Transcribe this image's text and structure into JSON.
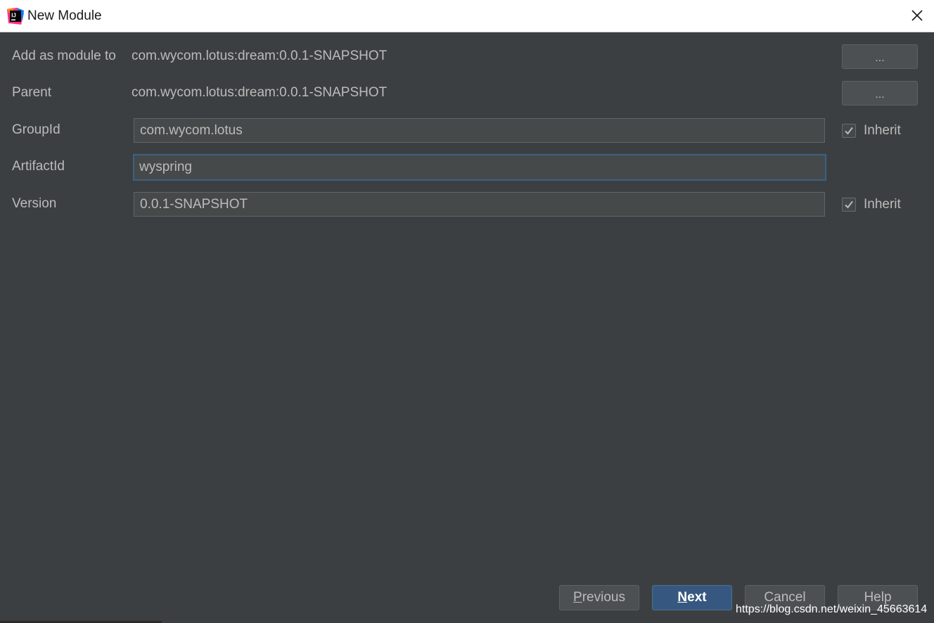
{
  "window": {
    "title": "New Module",
    "icon": "intellij-idea-icon"
  },
  "form": {
    "add_as_module_to": {
      "label": "Add as module to",
      "value": "com.wycom.lotus:dream:0.0.1-SNAPSHOT",
      "button_label": "..."
    },
    "parent": {
      "label": "Parent",
      "value": "com.wycom.lotus:dream:0.0.1-SNAPSHOT",
      "button_label": "..."
    },
    "group_id": {
      "label": "GroupId",
      "value": "com.wycom.lotus",
      "inherit_label": "Inherit",
      "inherit_checked": true
    },
    "artifact_id": {
      "label": "ArtifactId",
      "value": "wyspring"
    },
    "version": {
      "label": "Version",
      "value": "0.0.1-SNAPSHOT",
      "inherit_label": "Inherit",
      "inherit_checked": true
    }
  },
  "buttons": {
    "previous": {
      "mnemonic": "P",
      "rest": "revious"
    },
    "next": {
      "mnemonic": "N",
      "rest": "ext"
    },
    "cancel": "Cancel",
    "help": "Help"
  },
  "watermark": "https://blog.csdn.net/weixin_45663614",
  "colors": {
    "background": "#3c3f41",
    "text": "#bbbbbb",
    "primary_button": "#365880",
    "focus_border": "#3d6185"
  }
}
